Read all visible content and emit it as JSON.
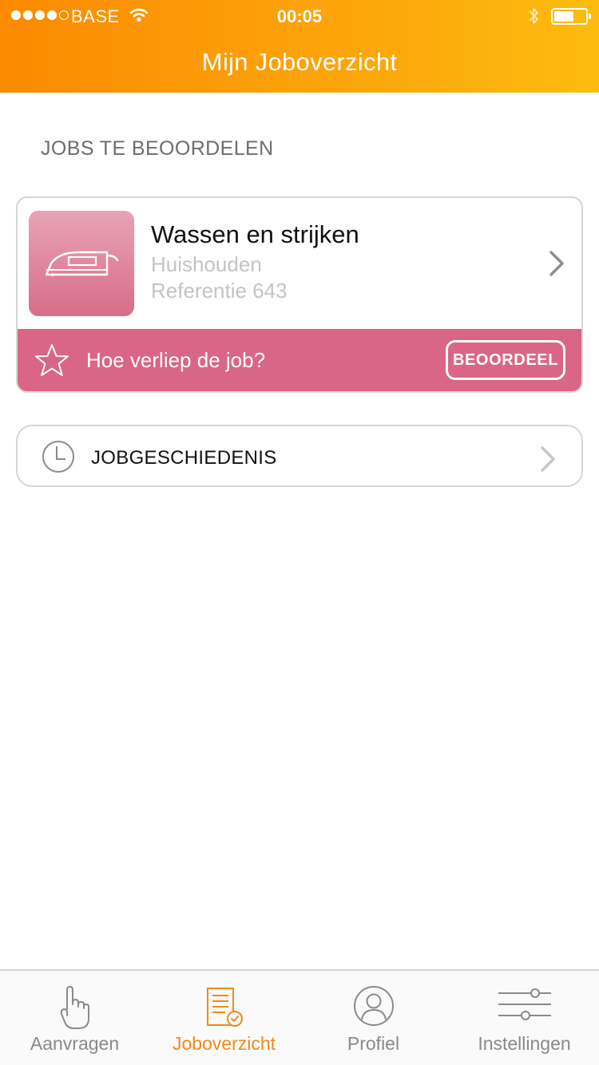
{
  "status_bar": {
    "carrier": "BASE",
    "time": "00:05",
    "signal_bars_filled": 4,
    "signal_bars_total": 5,
    "battery_level": 0.5
  },
  "header": {
    "title": "Mijn Joboverzicht"
  },
  "section": {
    "heading": "JOBS TE BEOORDELEN"
  },
  "job": {
    "title": "Wassen en strijken",
    "category": "Huishouden",
    "reference": "Referentie 643",
    "icon": "iron-icon",
    "rating_prompt": "Hoe verliep de job?",
    "rate_button_label": "BEOORDEEL"
  },
  "history": {
    "label": "JOBGESCHIEDENIS",
    "icon": "clock-icon"
  },
  "tabs": [
    {
      "label": "Aanvragen",
      "icon": "hand-pointer-icon",
      "active": false
    },
    {
      "label": "Joboverzicht",
      "icon": "document-check-icon",
      "active": true
    },
    {
      "label": "Profiel",
      "icon": "user-icon",
      "active": false
    },
    {
      "label": "Instellingen",
      "icon": "sliders-icon",
      "active": false
    }
  ],
  "colors": {
    "header_gradient_start": "#fb8a00",
    "header_gradient_end": "#fdbb0f",
    "rating_bar": "#d96684",
    "active_tab": "#f28a19"
  }
}
